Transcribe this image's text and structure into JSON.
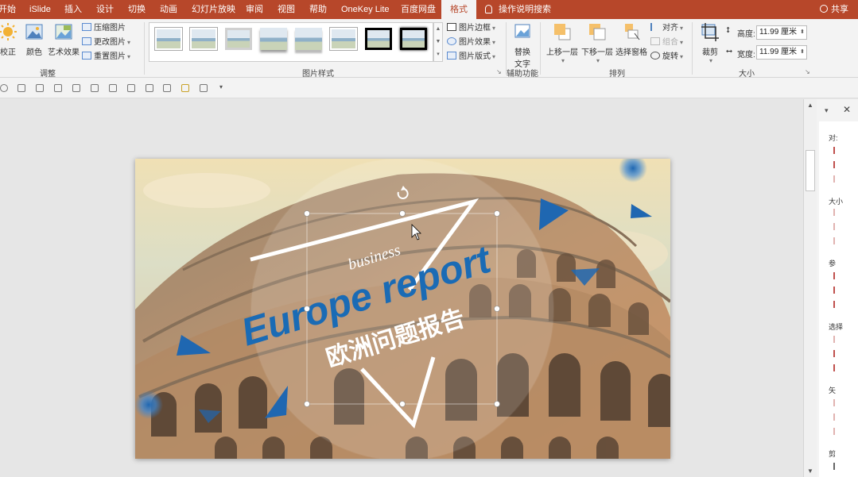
{
  "tabs": [
    {
      "label": "开始",
      "active": false
    },
    {
      "label": "iSlide",
      "active": false
    },
    {
      "label": "插入",
      "active": false
    },
    {
      "label": "设计",
      "active": false
    },
    {
      "label": "切换",
      "active": false
    },
    {
      "label": "动画",
      "active": false
    },
    {
      "label": "幻灯片放映",
      "active": false
    },
    {
      "label": "审阅",
      "active": false
    },
    {
      "label": "视图",
      "active": false
    },
    {
      "label": "帮助",
      "active": false
    },
    {
      "label": "OneKey Lite",
      "active": false
    },
    {
      "label": "百度网盘",
      "active": false
    },
    {
      "label": "格式",
      "active": true
    }
  ],
  "tell_me": "操作说明搜索",
  "share": "共享",
  "ribbon": {
    "adjust": {
      "correct": "校正",
      "color": "颜色",
      "artistic": "艺术效果",
      "compress": "压缩图片",
      "change": "更改图片",
      "reset": "重置图片",
      "label": "调整"
    },
    "styles": {
      "border": "图片边框",
      "effects": "图片效果",
      "layout": "图片版式",
      "label": "图片样式"
    },
    "accessibility": {
      "alt_text_line1": "替换",
      "alt_text_line2": "文字",
      "label": "辅助功能"
    },
    "arrange": {
      "forward": "上移一层",
      "backward": "下移一层",
      "selection_pane": "选择窗格",
      "align": "对齐",
      "group": "组合",
      "rotate": "旋转",
      "label": "排列"
    },
    "size": {
      "crop": "裁剪",
      "height_label": "高度:",
      "height_value": "11.99 厘米",
      "width_label": "宽度:",
      "width_value": "11.99 厘米",
      "label": "大小"
    }
  },
  "slide": {
    "title": "Europe report",
    "subtitle": "business",
    "chinese_title": "欧洲问题报告"
  },
  "pane": {
    "labels": [
      "对:",
      "大小",
      "参",
      "选择",
      "矢",
      "剪"
    ]
  },
  "colors": {
    "accent": "#b7472a",
    "title_blue": "#1a6bb5",
    "triangle_blue": "#1f67b1"
  }
}
